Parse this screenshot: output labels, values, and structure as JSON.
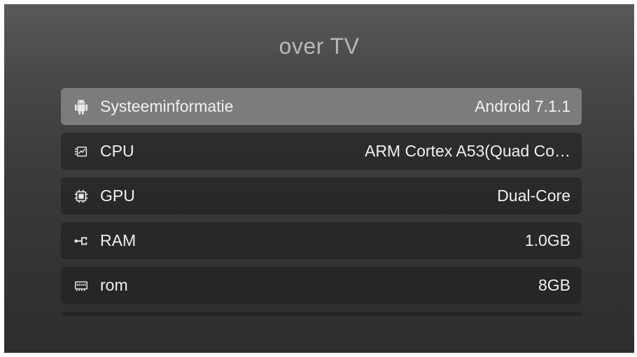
{
  "screen": {
    "title": "over TV"
  },
  "items": [
    {
      "icon": "android-icon",
      "label": "Systeeminformatie",
      "value": "Android 7.1.1",
      "selected": true
    },
    {
      "icon": "cpu-icon",
      "label": "CPU",
      "value": "ARM Cortex A53(Quad Co…",
      "selected": false
    },
    {
      "icon": "chip-icon",
      "label": "GPU",
      "value": "Dual-Core",
      "selected": false
    },
    {
      "icon": "usb-icon",
      "label": "RAM",
      "value": "1.0GB",
      "selected": false
    },
    {
      "icon": "memory-icon",
      "label": "rom",
      "value": "8GB",
      "selected": false
    }
  ],
  "colors": {
    "selected_row": "#7c7c7c",
    "row": "#2a2a2a",
    "text": "#f0f0f0",
    "title": "#b8b8b8"
  }
}
